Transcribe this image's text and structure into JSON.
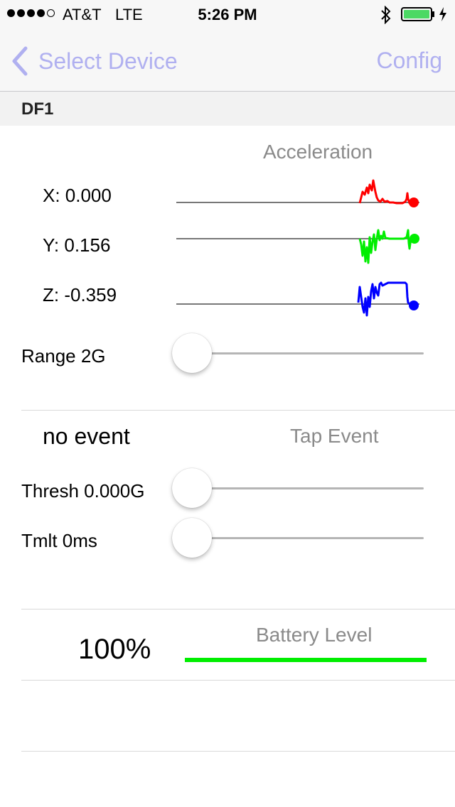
{
  "status_bar": {
    "carrier": "AT&T",
    "network": "LTE",
    "time": "5:26 PM",
    "signal_bars_filled": 4,
    "signal_bars_total": 5,
    "battery_fraction": 0.9,
    "icons": [
      "bluetooth-icon",
      "battery-icon",
      "charging-bolt-icon"
    ]
  },
  "nav": {
    "back_label": "Select Device",
    "back_icon": "chevron-left-icon",
    "config_label": "Config"
  },
  "section": {
    "title": "DF1"
  },
  "acceleration": {
    "title": "Acceleration",
    "x_label": "X: 0.000",
    "y_label": "Y: 0.156",
    "z_label": "Z: -0.359",
    "colors": {
      "x": "#ff0000",
      "y": "#00ee00",
      "z": "#0000ff"
    },
    "range_label": "Range 2G",
    "range_slider_value": 0
  },
  "tap": {
    "status": "no event",
    "title": "Tap Event",
    "thresh_label": "Thresh 0.000G",
    "thresh_slider_value": 0,
    "tmlt_label": "Tmlt 0ms",
    "tmlt_slider_value": 0
  },
  "battery": {
    "percent_label": "100%",
    "title": "Battery Level",
    "level": 1.0,
    "bar_color": "#00ee00"
  }
}
